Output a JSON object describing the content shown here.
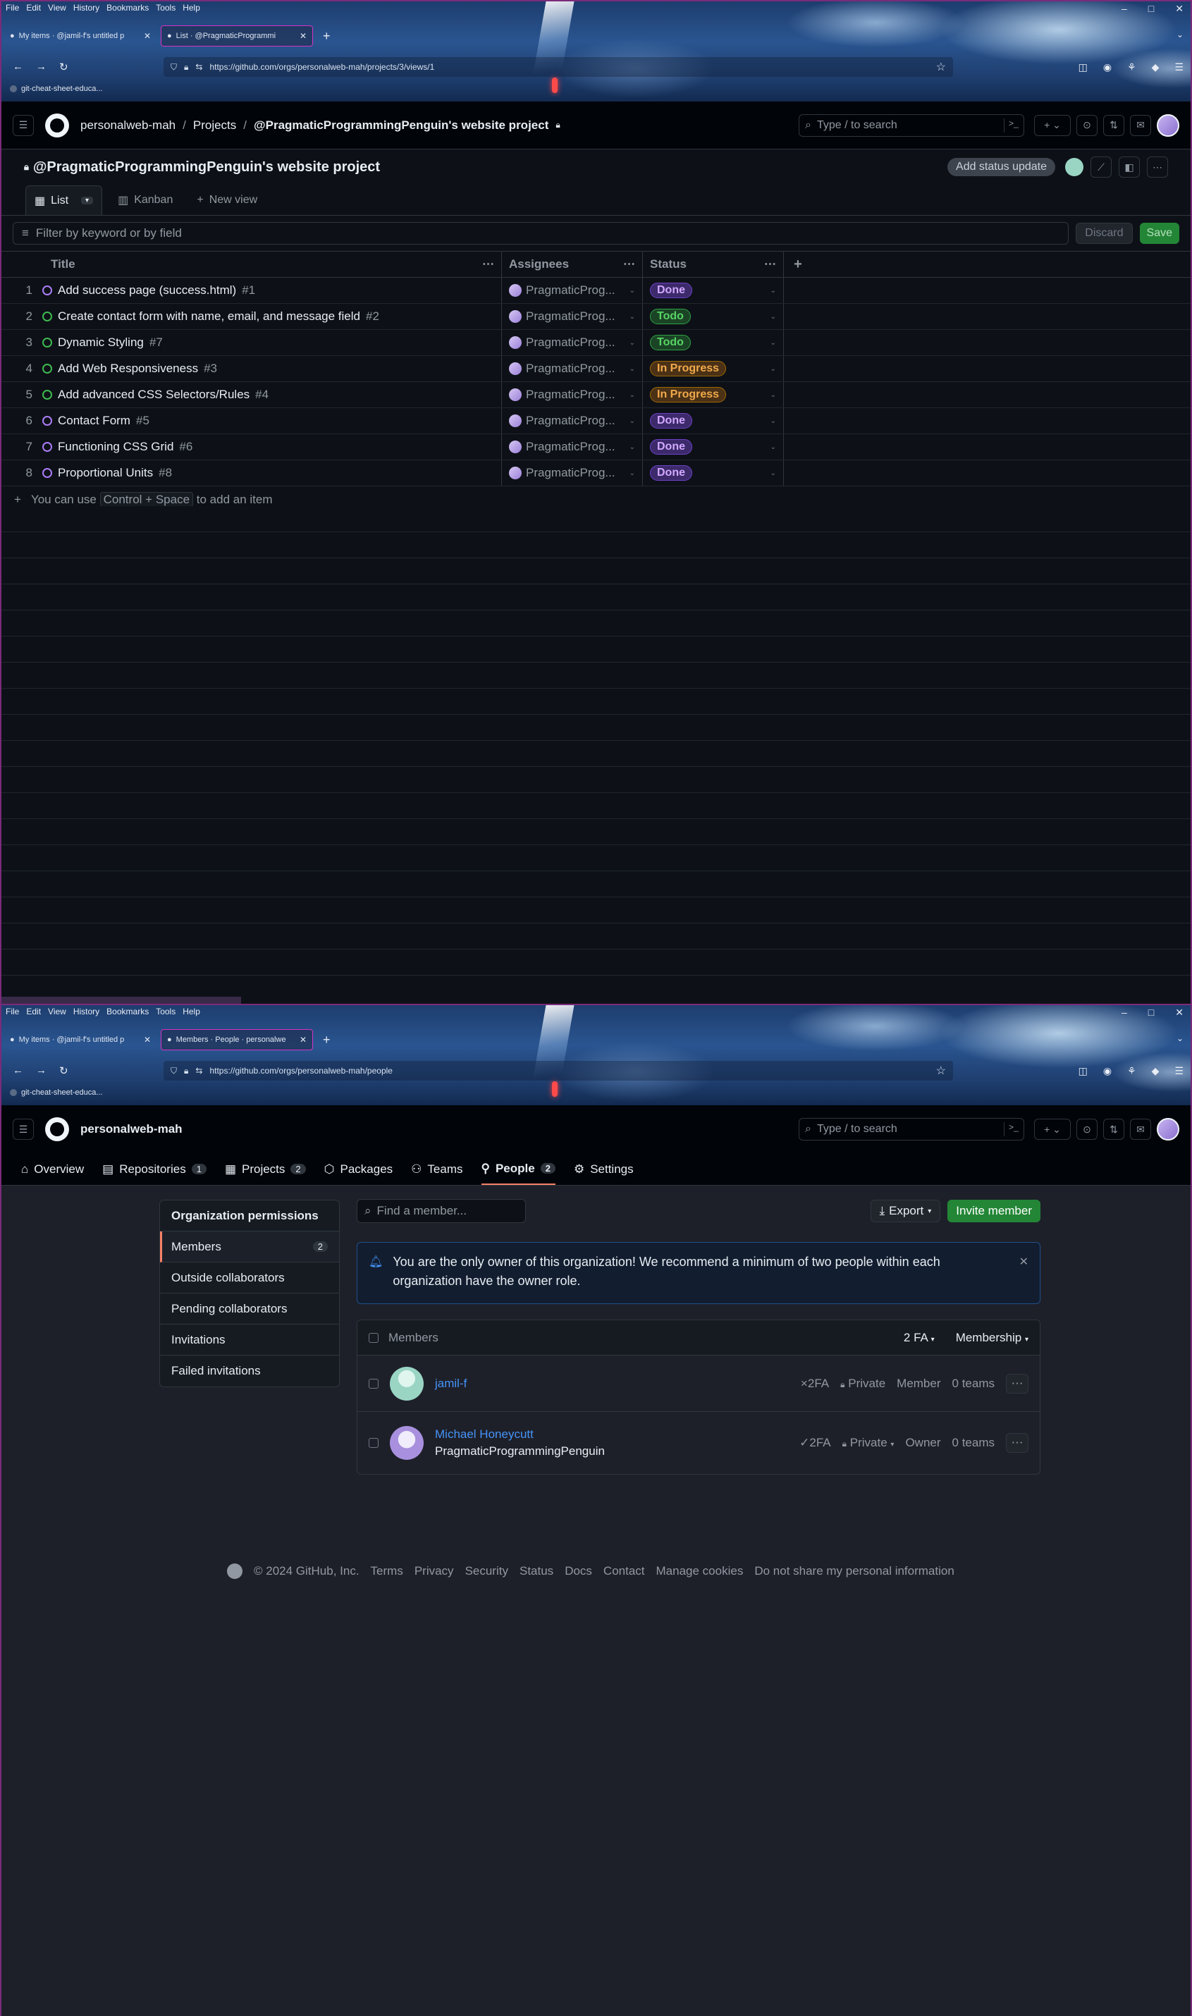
{
  "browser": {
    "menu": [
      "File",
      "Edit",
      "View",
      "History",
      "Bookmarks",
      "Tools",
      "Help"
    ],
    "bookmark": "git-cheat-sheet-educa..."
  },
  "window1": {
    "tabs": [
      {
        "label": "My items · @jamil-f's untitled p"
      },
      {
        "label": "List · @PragmaticProgrammi"
      }
    ],
    "url": "https://github.com/orgs/personalweb-mah/projects/3/views/1",
    "breadcrumb": {
      "org": "personalweb-mah",
      "section": "Projects",
      "project": "@PragmaticProgrammingPenguin's website project"
    },
    "search_placeholder": "Type / to search",
    "project_title": "@PragmaticProgrammingPenguin's website project",
    "status_update": "Add status update",
    "views": {
      "list": "List",
      "kanban": "Kanban",
      "new": "New view"
    },
    "filter_placeholder": "Filter by keyword or by field",
    "discard": "Discard",
    "save": "Save",
    "columns": {
      "title": "Title",
      "assignees": "Assignees",
      "status": "Status"
    },
    "rows": [
      {
        "num": "1",
        "title": "Add success page (success.html)",
        "ref": "#1",
        "assignee": "PragmaticProg...",
        "status": "Done",
        "state": "closed",
        "pill": "done"
      },
      {
        "num": "2",
        "title": "Create contact form with name, email, and message field",
        "ref": "#2",
        "assignee": "PragmaticProg...",
        "status": "Todo",
        "state": "open",
        "pill": "todo"
      },
      {
        "num": "3",
        "title": "Dynamic Styling",
        "ref": "#7",
        "assignee": "PragmaticProg...",
        "status": "Todo",
        "state": "open",
        "pill": "todo"
      },
      {
        "num": "4",
        "title": "Add Web Responsiveness",
        "ref": "#3",
        "assignee": "PragmaticProg...",
        "status": "In Progress",
        "state": "open",
        "pill": "progress"
      },
      {
        "num": "5",
        "title": "Add advanced CSS Selectors/Rules",
        "ref": "#4",
        "assignee": "PragmaticProg...",
        "status": "In Progress",
        "state": "open",
        "pill": "progress"
      },
      {
        "num": "6",
        "title": "Contact Form",
        "ref": "#5",
        "assignee": "PragmaticProg...",
        "status": "Done",
        "state": "closed",
        "pill": "done"
      },
      {
        "num": "7",
        "title": "Functioning CSS Grid",
        "ref": "#6",
        "assignee": "PragmaticProg...",
        "status": "Done",
        "state": "closed",
        "pill": "done"
      },
      {
        "num": "8",
        "title": "Proportional Units",
        "ref": "#8",
        "assignee": "PragmaticProg...",
        "status": "Done",
        "state": "closed",
        "pill": "done"
      }
    ],
    "add_item": {
      "prefix": "You can use",
      "key1": "Control",
      "plus": "+",
      "key2": "Space",
      "suffix": "to add an item"
    }
  },
  "window2": {
    "tabs": [
      {
        "label": "My items · @jamil-f's untitled p"
      },
      {
        "label": "Members · People · personalwe"
      }
    ],
    "url": "https://github.com/orgs/personalweb-mah/people",
    "org": "personalweb-mah",
    "search_placeholder": "Type / to search",
    "nav": [
      {
        "label": "Overview",
        "count": ""
      },
      {
        "label": "Repositories",
        "count": "1"
      },
      {
        "label": "Projects",
        "count": "2"
      },
      {
        "label": "Packages",
        "count": ""
      },
      {
        "label": "Teams",
        "count": ""
      },
      {
        "label": "People",
        "count": "2"
      },
      {
        "label": "Settings",
        "count": ""
      }
    ],
    "sidebar": {
      "heading": "Organization permissions",
      "items": [
        {
          "label": "Members",
          "count": "2"
        },
        {
          "label": "Outside collaborators"
        },
        {
          "label": "Pending collaborators"
        },
        {
          "label": "Invitations"
        },
        {
          "label": "Failed invitations"
        }
      ]
    },
    "find_placeholder": "Find a member...",
    "export": "Export",
    "invite": "Invite member",
    "flash": "You are the only owner of this organization! We recommend a minimum of two people within each organization have the owner role.",
    "members_header": {
      "label": "Members",
      "filter_2fa": "2 FA",
      "filter_membership": "Membership"
    },
    "members": [
      {
        "name": "jamil-f",
        "username": "",
        "twofa": "2FA",
        "twofa_mark": "×",
        "visibility": "Private",
        "role": "Member",
        "teams": "0 teams"
      },
      {
        "name": "Michael Honeycutt",
        "username": "PragmaticProgrammingPenguin",
        "twofa": "2FA",
        "twofa_mark": "✓",
        "visibility": "Private",
        "role": "Owner",
        "teams": "0 teams"
      }
    ],
    "footer": [
      "© 2024 GitHub, Inc.",
      "Terms",
      "Privacy",
      "Security",
      "Status",
      "Docs",
      "Contact",
      "Manage cookies",
      "Do not share my personal information"
    ]
  }
}
